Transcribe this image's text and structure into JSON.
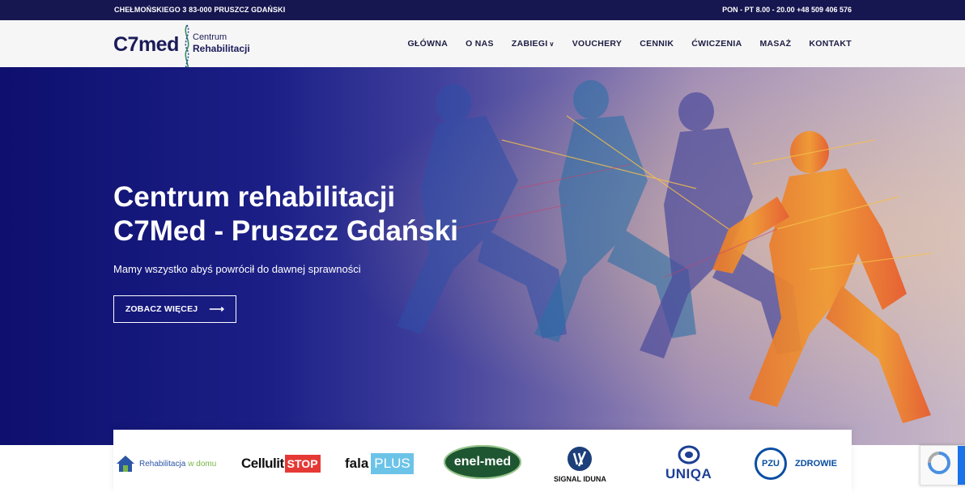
{
  "topbar": {
    "address": "CHEŁMOŃSKIEGO 3 83-000 PRUSZCZ GDAŃSKI",
    "hours": "PON - PT 8.00 - 20.00 +48 509 406 576"
  },
  "logo": {
    "brand": "C7med",
    "line1": "Centrum",
    "line2": "Rehabilitacji"
  },
  "menu": {
    "items": [
      "GŁÓWNA",
      "O NAS",
      "ZABIEGI",
      "VOUCHERY",
      "CENNIK",
      "ĆWICZENIA",
      "MASAŻ",
      "KONTAKT"
    ],
    "dropdown_caret": "∨"
  },
  "hero": {
    "title_line1": "Centrum rehabilitacji",
    "title_line2": "C7Med - Pruszcz Gdański",
    "subtitle": "Mamy wszystko abyś powrócił do dawnej sprawności",
    "button_label": "ZOBACZ WIĘCEJ",
    "button_arrow": "⟶"
  },
  "partners": {
    "rehab_a": "Rehabilitacja",
    "rehab_b": "w domu",
    "cellulit_a": "Cellulit",
    "cellulit_b": "STOP",
    "fala_a": "fala",
    "fala_b": "PLUS",
    "enelmed": "enel-med",
    "signal": "SIGNAL IDUNA",
    "uniqa": "UNIQA",
    "pzu_mark": "PZU",
    "pzu_text": "ZDROWIE"
  },
  "colors": {
    "topbar": "#161650",
    "navy": "#1b1b5a",
    "enelmed_green": "#1e5631",
    "cellulit_red": "#e53935",
    "fala_blue": "#6cc3e8",
    "uniqa_blue": "#1d3f94",
    "pzu_blue": "#0a4ea2"
  }
}
